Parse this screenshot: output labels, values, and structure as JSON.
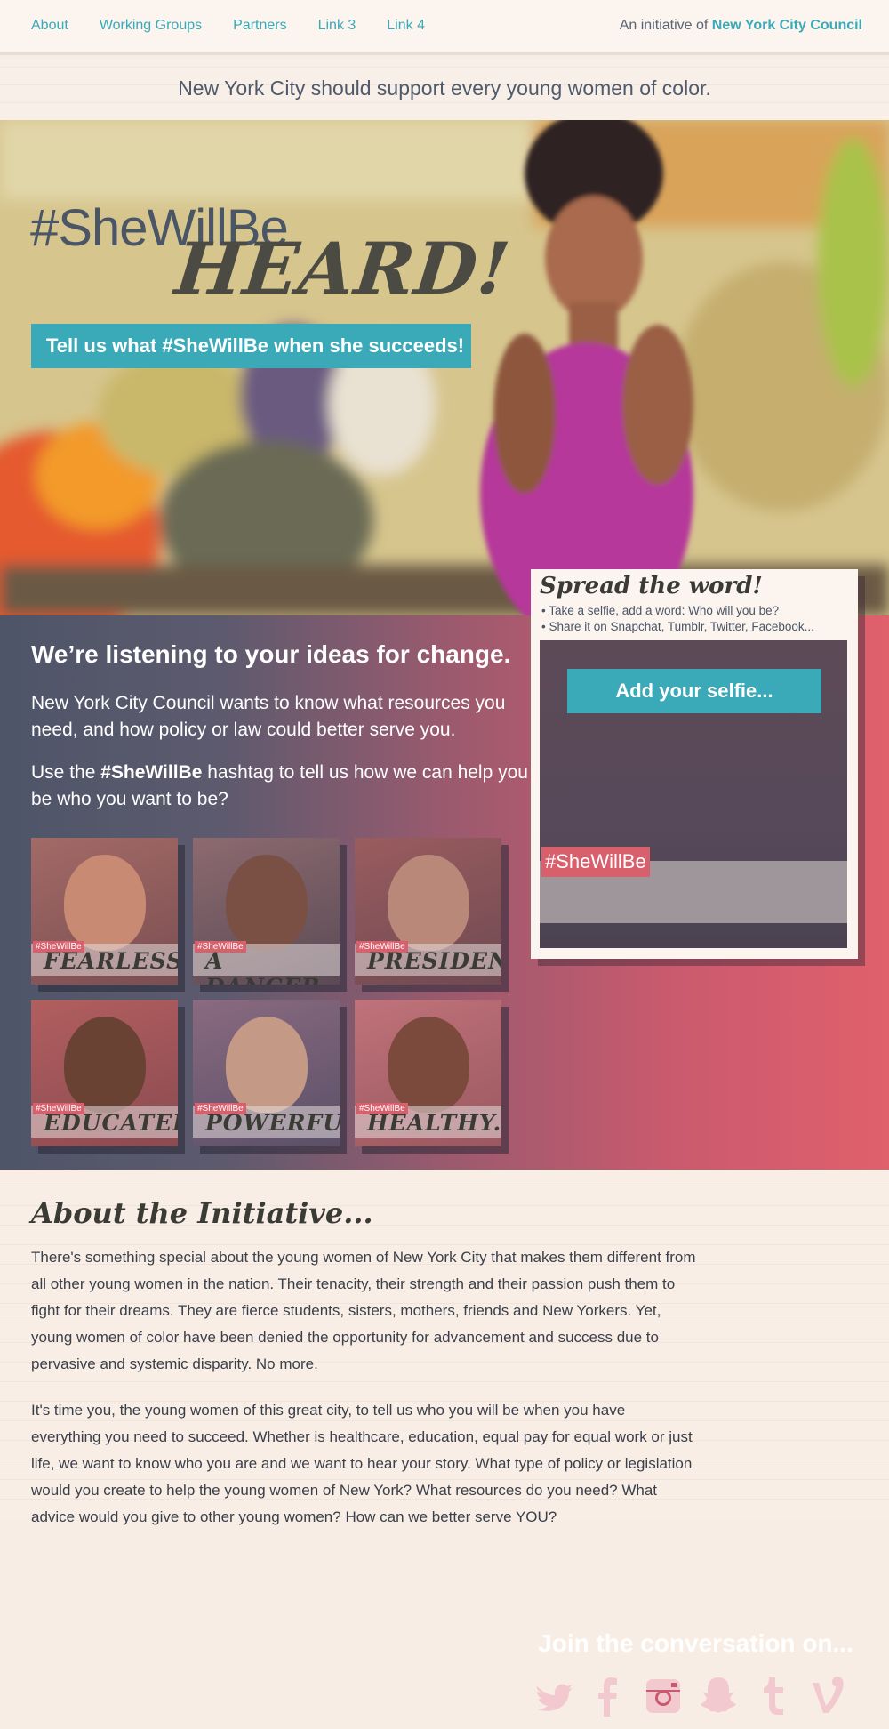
{
  "nav": {
    "links": [
      "About",
      "Working Groups",
      "Partners",
      "Link 3",
      "Link 4"
    ],
    "initiative_prefix": "An initiative of",
    "initiative_org": "New York City Council"
  },
  "tagline": "New York City should support every young women of color.",
  "hero": {
    "title_line1": "#SheWillBe",
    "title_line2": "HEARD!",
    "cta": "Tell us what #SheWillBe when she succeeds!"
  },
  "listening": {
    "heading": "We’re listening to your ideas for change.",
    "para1": "New York City Council wants to know what resources you need, and how policy or law could better serve you.",
    "para2_before": "Use the ",
    "para2_hashtag": "#SheWillBe",
    "para2_after": " hashtag to tell us how we can help you be who you want to be?"
  },
  "tiles": [
    {
      "tag": "#SheWillBe",
      "word": "FEARLESS"
    },
    {
      "tag": "#SheWillBe",
      "word": "A DANCER"
    },
    {
      "tag": "#SheWillBe",
      "word": "PRESIDENT"
    },
    {
      "tag": "#SheWillBe",
      "word": "EDUCATED"
    },
    {
      "tag": "#SheWillBe",
      "word": "POWERFUL"
    },
    {
      "tag": "#SheWillBe",
      "word": "HEALTHY."
    }
  ],
  "spread": {
    "heading": "Spread the word!",
    "bullet1": "• Take a selfie, add a word: Who will you be?",
    "bullet2": "• Share it on Snapchat, Tumblr, Twitter, Facebook...",
    "button": "Add your selfie...",
    "frame_tag": "#SheWillBe"
  },
  "join": {
    "heading": "Join the conversation on...",
    "icons": [
      "twitter-icon",
      "facebook-icon",
      "instagram-icon",
      "snapchat-icon",
      "tumblr-icon",
      "vine-icon"
    ]
  },
  "about": {
    "heading": "About the Initiative...",
    "para1": "There's something special about the young women of New York City that makes them different from all other young women in the nation. Their tenacity, their strength and their passion push them to fight for their dreams. They are fierce students, sisters, mothers, friends and New Yorkers. Yet, young women of color have been denied the opportunity for advancement and success due to pervasive and systemic disparity. No more.",
    "para2": "It's time you, the young women of this great city, to tell us who you will be when you have everything you need to succeed. Whether is healthcare, education, equal pay for equal work or just life, we want to know who you are and we want to hear your story. What type of policy or legislation would you create to help the young women of New York? What resources do you need? What advice would you give to other young women? How can we better serve YOU?"
  },
  "colors": {
    "accent": "#3aaab8",
    "band_left": "#4e5568",
    "band_right": "#e0606c",
    "tag_pink": "#d8606c"
  }
}
